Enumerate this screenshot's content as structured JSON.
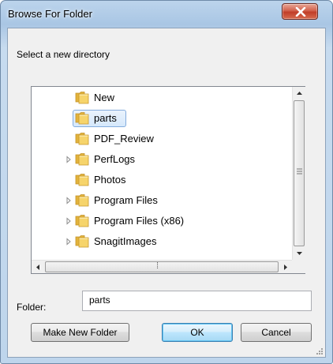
{
  "window": {
    "title": "Browse For Folder",
    "close_icon": "close-icon"
  },
  "dialog": {
    "description": "Select a new directory"
  },
  "tree": {
    "items": [
      {
        "label": "New",
        "expandable": false,
        "selected": false
      },
      {
        "label": "parts",
        "expandable": false,
        "selected": true
      },
      {
        "label": "PDF_Review",
        "expandable": false,
        "selected": false
      },
      {
        "label": "PerfLogs",
        "expandable": true,
        "selected": false
      },
      {
        "label": "Photos",
        "expandable": false,
        "selected": false
      },
      {
        "label": "Program Files",
        "expandable": true,
        "selected": false
      },
      {
        "label": "Program Files (x86)",
        "expandable": true,
        "selected": false
      },
      {
        "label": "SnagitImages",
        "expandable": true,
        "selected": false
      }
    ],
    "scrollbar_grip": "⁞"
  },
  "folder": {
    "label": "Folder:",
    "value": "parts"
  },
  "buttons": {
    "make_new_folder": "Make New Folder",
    "ok": "OK",
    "cancel": "Cancel"
  },
  "colors": {
    "title_bar": "#a9c6e4",
    "close_button": "#c13d28",
    "selection": "#d5e8fb",
    "folder_icon": "#f2c94c"
  }
}
